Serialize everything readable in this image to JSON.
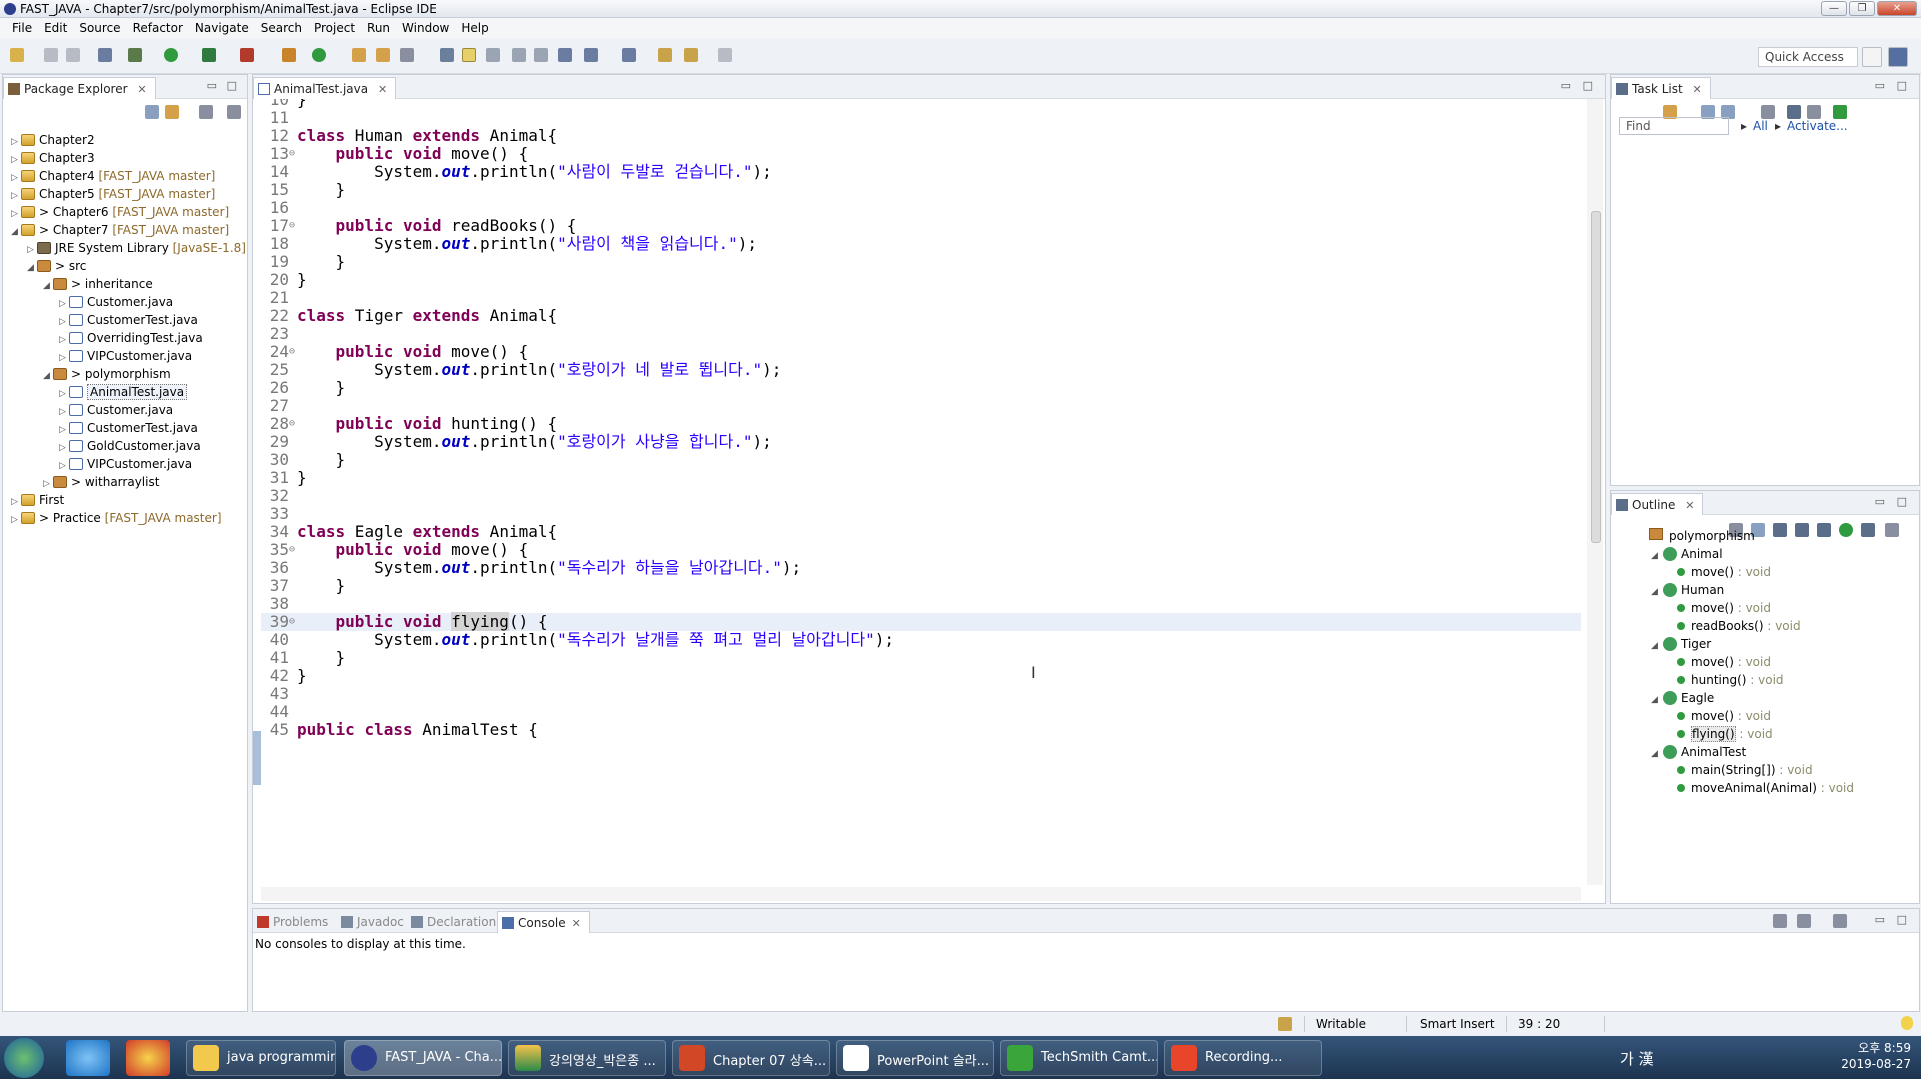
{
  "window": {
    "title": "FAST_JAVA - Chapter7/src/polymorphism/AnimalTest.java - Eclipse IDE",
    "buttons": [
      "—",
      "❐",
      "✕"
    ]
  },
  "menu": [
    "File",
    "Edit",
    "Source",
    "Refactor",
    "Navigate",
    "Search",
    "Project",
    "Run",
    "Window",
    "Help"
  ],
  "toolbar": {
    "quick_access": "Quick Access"
  },
  "package_explorer": {
    "tab": "Package Explorer",
    "close": "✕",
    "nodes": [
      {
        "label": "Chapter2",
        "git": ""
      },
      {
        "label": "Chapter3",
        "git": ""
      },
      {
        "label": "Chapter4",
        "git": "[FAST_JAVA master]"
      },
      {
        "label": "Chapter5",
        "git": "[FAST_JAVA master]"
      },
      {
        "label": "> Chapter6",
        "git": "[FAST_JAVA master]"
      },
      {
        "label": "> Chapter7",
        "git": "[FAST_JAVA master]"
      },
      {
        "label": "JRE System Library",
        "git": "[JavaSE-1.8]"
      },
      {
        "label": "> src",
        "git": ""
      },
      {
        "label": "> inheritance",
        "git": ""
      },
      {
        "label": "Customer.java",
        "git": ""
      },
      {
        "label": "CustomerTest.java",
        "git": ""
      },
      {
        "label": "OverridingTest.java",
        "git": ""
      },
      {
        "label": "VIPCustomer.java",
        "git": ""
      },
      {
        "label": "> polymorphism",
        "git": ""
      },
      {
        "label": "AnimalTest.java",
        "git": ""
      },
      {
        "label": "Customer.java",
        "git": ""
      },
      {
        "label": "CustomerTest.java",
        "git": ""
      },
      {
        "label": "GoldCustomer.java",
        "git": ""
      },
      {
        "label": "VIPCustomer.java",
        "git": ""
      },
      {
        "label": "> witharraylist",
        "git": ""
      },
      {
        "label": "First",
        "git": ""
      },
      {
        "label": "> Practice",
        "git": "[FAST_JAVA master]"
      }
    ]
  },
  "editor": {
    "tab": "AnimalTest.java",
    "close": "✕",
    "lines": [
      {
        "n": "10",
        "t": "}"
      },
      {
        "n": "11",
        "t": ""
      },
      {
        "n": "12",
        "t": "class Human extends Animal{"
      },
      {
        "n": "13",
        "t": "    public void move() {"
      },
      {
        "n": "14",
        "t": "        System.out.println(\"사람이 두발로 걷습니다.\");"
      },
      {
        "n": "15",
        "t": "    }"
      },
      {
        "n": "16",
        "t": ""
      },
      {
        "n": "17",
        "t": "    public void readBooks() {"
      },
      {
        "n": "18",
        "t": "        System.out.println(\"사람이 책을 읽습니다.\");"
      },
      {
        "n": "19",
        "t": "    }"
      },
      {
        "n": "20",
        "t": "}"
      },
      {
        "n": "21",
        "t": ""
      },
      {
        "n": "22",
        "t": "class Tiger extends Animal{"
      },
      {
        "n": "23",
        "t": ""
      },
      {
        "n": "24",
        "t": "    public void move() {"
      },
      {
        "n": "25",
        "t": "        System.out.println(\"호랑이가 네 발로 뜁니다.\");"
      },
      {
        "n": "26",
        "t": "    }"
      },
      {
        "n": "27",
        "t": ""
      },
      {
        "n": "28",
        "t": "    public void hunting() {"
      },
      {
        "n": "29",
        "t": "        System.out.println(\"호랑이가 사냥을 합니다.\");"
      },
      {
        "n": "30",
        "t": "    }"
      },
      {
        "n": "31",
        "t": "}"
      },
      {
        "n": "32",
        "t": ""
      },
      {
        "n": "33",
        "t": ""
      },
      {
        "n": "34",
        "t": "class Eagle extends Animal{"
      },
      {
        "n": "35",
        "t": "    public void move() {"
      },
      {
        "n": "36",
        "t": "        System.out.println(\"독수리가 하늘을 날아갑니다.\");"
      },
      {
        "n": "37",
        "t": "    }"
      },
      {
        "n": "38",
        "t": ""
      },
      {
        "n": "39",
        "t": "    public void flying() {"
      },
      {
        "n": "40",
        "t": "        System.out.println(\"독수리가 날개를 쭉 펴고 멀리 날아갑니다\");"
      },
      {
        "n": "41",
        "t": "    }"
      },
      {
        "n": "42",
        "t": "}"
      },
      {
        "n": "43",
        "t": ""
      },
      {
        "n": "44",
        "t": ""
      },
      {
        "n": "45",
        "t": "public class AnimalTest {"
      }
    ]
  },
  "task_list": {
    "tab": "Task List",
    "close": "✕",
    "find_placeholder": "Find",
    "all": "All",
    "activate": "Activate..."
  },
  "outline": {
    "tab": "Outline",
    "close": "✕",
    "items": [
      {
        "label": "polymorphism",
        "type": ""
      },
      {
        "label": "Animal",
        "type": ""
      },
      {
        "label": "move()",
        "type": " : void"
      },
      {
        "label": "Human",
        "type": ""
      },
      {
        "label": "move()",
        "type": " : void"
      },
      {
        "label": "readBooks()",
        "type": " : void"
      },
      {
        "label": "Tiger",
        "type": ""
      },
      {
        "label": "move()",
        "type": " : void"
      },
      {
        "label": "hunting()",
        "type": " : void"
      },
      {
        "label": "Eagle",
        "type": ""
      },
      {
        "label": "move()",
        "type": " : void"
      },
      {
        "label": "flying()",
        "type": " : void"
      },
      {
        "label": "AnimalTest",
        "type": ""
      },
      {
        "label": "main(String[])",
        "type": " : void"
      },
      {
        "label": "moveAnimal(Animal)",
        "type": " : void"
      }
    ]
  },
  "bottom": {
    "tabs": [
      "Problems",
      "Javadoc",
      "Declaration",
      "Console"
    ],
    "close": "✕",
    "message": "No consoles to display at this time."
  },
  "status": {
    "writable": "Writable",
    "insert": "Smart Insert",
    "position": "39 : 20"
  },
  "taskbar": {
    "buttons": [
      "java programmin...",
      "FAST_JAVA - Cha...",
      "강의영상_박은종 ...",
      "Chapter 07 상속...",
      "PowerPoint 슬라...",
      "TechSmith Camt...",
      "Recording..."
    ],
    "ime": "가 漢",
    "time": "오후 8:59",
    "date": "2019-08-27"
  }
}
